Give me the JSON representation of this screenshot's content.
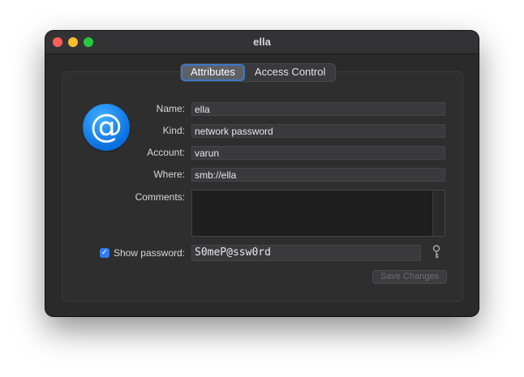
{
  "window": {
    "title": "ella"
  },
  "tabs": [
    {
      "label": "Attributes",
      "active": true
    },
    {
      "label": "Access Control",
      "active": false
    }
  ],
  "item_icon": {
    "icon": "at-sign-icon",
    "glyph": "@",
    "color": "#1a86f0"
  },
  "fields": {
    "name": {
      "label": "Name:",
      "value": "ella"
    },
    "kind": {
      "label": "Kind:",
      "value": "network password"
    },
    "account": {
      "label": "Account:",
      "value": "varun"
    },
    "where": {
      "label": "Where:",
      "value": "smb://ella"
    },
    "comments": {
      "label": "Comments:",
      "value": ""
    }
  },
  "show_password": {
    "label": "Show password:",
    "checked": true,
    "check_glyph": "✓",
    "value": "S0meP@ssw0rd"
  },
  "key_button": {
    "icon": "key-icon"
  },
  "save_button": {
    "label": "Save Changes",
    "enabled": false
  },
  "colors": {
    "accent": "#2f7cf6",
    "window_bg": "#2a2a2b",
    "close": "#fe5f57",
    "minimize": "#febc2e",
    "maximize": "#28c840"
  }
}
